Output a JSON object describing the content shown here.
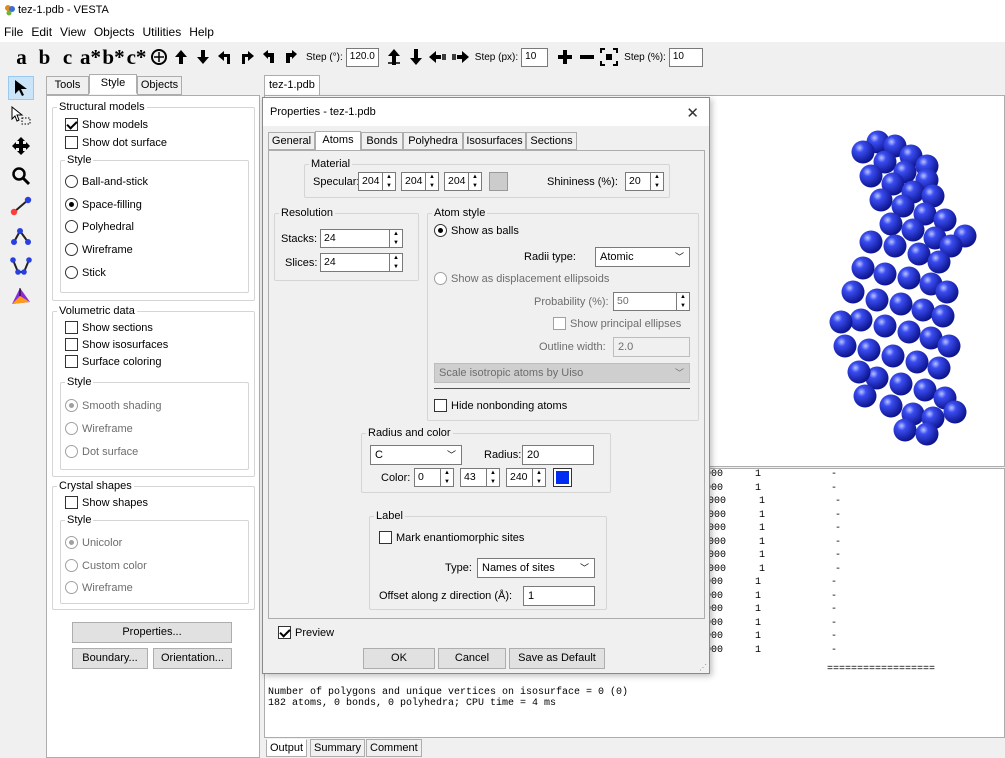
{
  "window": {
    "title": "tez-1.pdb - VESTA"
  },
  "menu": [
    "File",
    "Edit",
    "View",
    "Objects",
    "Utilities",
    "Help"
  ],
  "toolbar": {
    "axes": [
      "a",
      "b",
      "c",
      "a*",
      "b*",
      "c*"
    ],
    "step_deg_label": "Step (°):",
    "step_deg_value": "120.0",
    "step_px_label": "Step (px):",
    "step_px_value": "10",
    "step_pct_label": "Step (%):",
    "step_pct_value": "10"
  },
  "left_panel": {
    "tabs": [
      "Tools",
      "Style",
      "Objects"
    ],
    "structural_models": {
      "title": "Structural models",
      "show_models": "Show models",
      "show_dot_surface": "Show dot surface",
      "style_title": "Style",
      "styles": [
        "Ball-and-stick",
        "Space-filling",
        "Polyhedral",
        "Wireframe",
        "Stick"
      ]
    },
    "volumetric": {
      "title": "Volumetric data",
      "show_sections": "Show sections",
      "show_isosurfaces": "Show isosurfaces",
      "surface_coloring": "Surface coloring",
      "style_title": "Style",
      "styles": [
        "Smooth shading",
        "Wireframe",
        "Dot surface"
      ]
    },
    "crystal_shapes": {
      "title": "Crystal shapes",
      "show_shapes": "Show shapes",
      "style_title": "Style",
      "styles": [
        "Unicolor",
        "Custom color",
        "Wireframe"
      ]
    },
    "properties_button": "Properties...",
    "boundary_button": "Boundary...",
    "orientation_button": "Orientation..."
  },
  "document_tab": "tez-1.pdb",
  "dialog": {
    "title": "Properties - tez-1.pdb",
    "tabs": [
      "General",
      "Atoms",
      "Bonds",
      "Polyhedra",
      "Isosurfaces",
      "Sections"
    ],
    "material": {
      "title": "Material",
      "specular_label": "Specular:",
      "specular": [
        "204",
        "204",
        "204"
      ],
      "shininess_label": "Shininess (%):",
      "shininess": "20"
    },
    "resolution": {
      "title": "Resolution",
      "stacks_label": "Stacks:",
      "stacks": "24",
      "slices_label": "Slices:",
      "slices": "24"
    },
    "atom_style": {
      "title": "Atom style",
      "show_as_balls": "Show as balls",
      "radii_type_label": "Radii type:",
      "radii_type": "Atomic",
      "show_as_ellipsoids": "Show as displacement ellipsoids",
      "probability_label": "Probability (%):",
      "probability": "50",
      "show_principal": "Show principal ellipses",
      "outline_label": "Outline width:",
      "outline": "2.0",
      "scale_option": "Scale isotropic atoms by Uiso",
      "hide_nonbonding": "Hide nonbonding atoms"
    },
    "radius_color": {
      "title": "Radius and color",
      "element": "C",
      "radius_label": "Radius:",
      "radius": "20",
      "color_label": "Color:",
      "rgb": [
        "0",
        "43",
        "240"
      ],
      "swatch": "#002bf0"
    },
    "label": {
      "title": "Label",
      "mark_enantio": "Mark enantiomorphic sites",
      "type_label": "Type:",
      "type": "Names of sites",
      "offset_label": "Offset along z direction (Å):",
      "offset": "1"
    },
    "preview": "Preview",
    "ok": "OK",
    "cancel": "Cancel",
    "save_default": "Save as Default"
  },
  "output_rows": [
    {
      "c1": "000",
      "c2": "1",
      "c3": "-"
    },
    {
      "c1": "000",
      "c2": "1",
      "c3": "-"
    },
    {
      "c1": ".000",
      "c2": "1",
      "c3": "-"
    },
    {
      "c1": ".000",
      "c2": "1",
      "c3": "-"
    },
    {
      "c1": ".000",
      "c2": "1",
      "c3": "-"
    },
    {
      "c1": ".000",
      "c2": "1",
      "c3": "-"
    },
    {
      "c1": ".000",
      "c2": "1",
      "c3": "-"
    },
    {
      "c1": ".000",
      "c2": "1",
      "c3": "-"
    },
    {
      "c1": "000",
      "c2": "1",
      "c3": "-"
    },
    {
      "c1": "000",
      "c2": "1",
      "c3": "-"
    },
    {
      "c1": "000",
      "c2": "1",
      "c3": "-"
    },
    {
      "c1": "000",
      "c2": "1",
      "c3": "-"
    },
    {
      "c1": "000",
      "c2": "1",
      "c3": "-"
    },
    {
      "c1": "000",
      "c2": "1",
      "c3": "-"
    }
  ],
  "output_separator": "==================",
  "output_text": {
    "line1": "Number of polygons and unique vertices on isosurface = 0 (0)",
    "line2": "182 atoms, 0 bonds, 0 polyhedra; CPU time = 4 ms"
  },
  "bottom_tabs": [
    "Output",
    "Summary",
    "Comment"
  ],
  "colors": {
    "atom_blue": "#1a2bd8",
    "selection": "#cce4f7"
  }
}
